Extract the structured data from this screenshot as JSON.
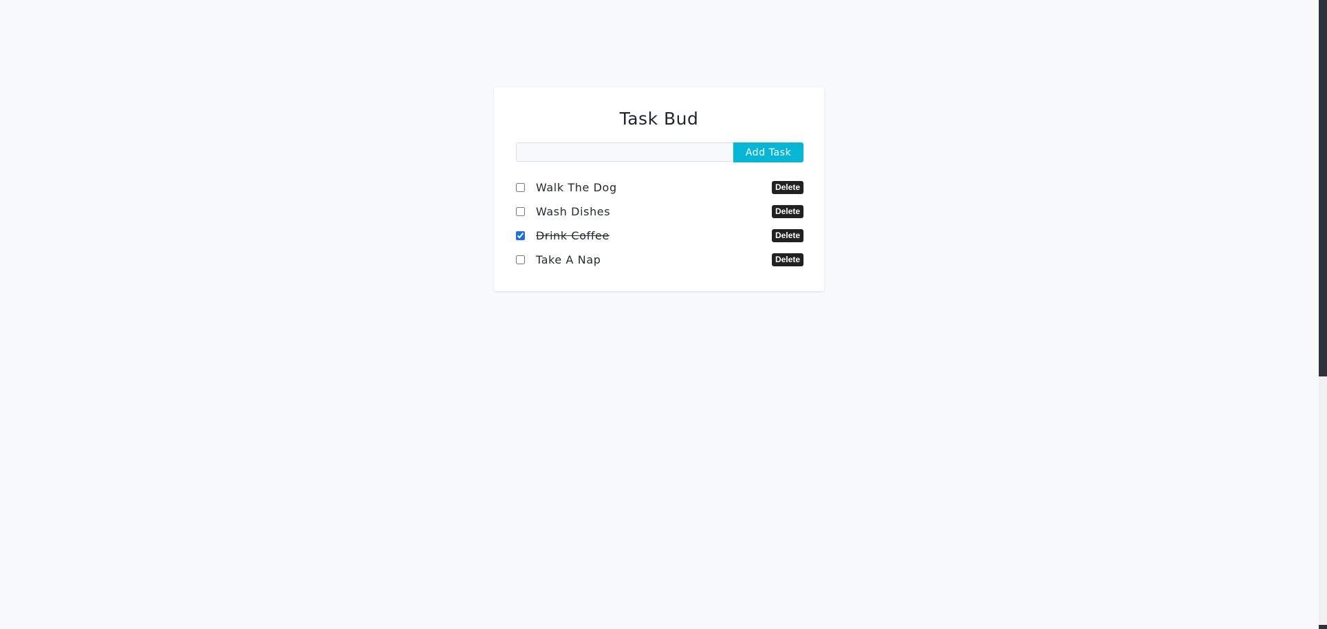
{
  "app": {
    "title": "Task Bud"
  },
  "add_form": {
    "input_value": "",
    "input_placeholder": "",
    "add_button_label": "Add Task"
  },
  "tasks": [
    {
      "label": "Walk The Dog",
      "completed": false,
      "delete_label": "Delete"
    },
    {
      "label": "Wash Dishes",
      "completed": false,
      "delete_label": "Delete"
    },
    {
      "label": "Drink Coffee",
      "completed": true,
      "delete_label": "Delete"
    },
    {
      "label": "Take A Nap",
      "completed": false,
      "delete_label": "Delete"
    }
  ],
  "colors": {
    "background": "#f8f9fb",
    "card": "#ffffff",
    "accent": "#07b6d5",
    "delete_button": "#212121",
    "text": "#24292f"
  }
}
